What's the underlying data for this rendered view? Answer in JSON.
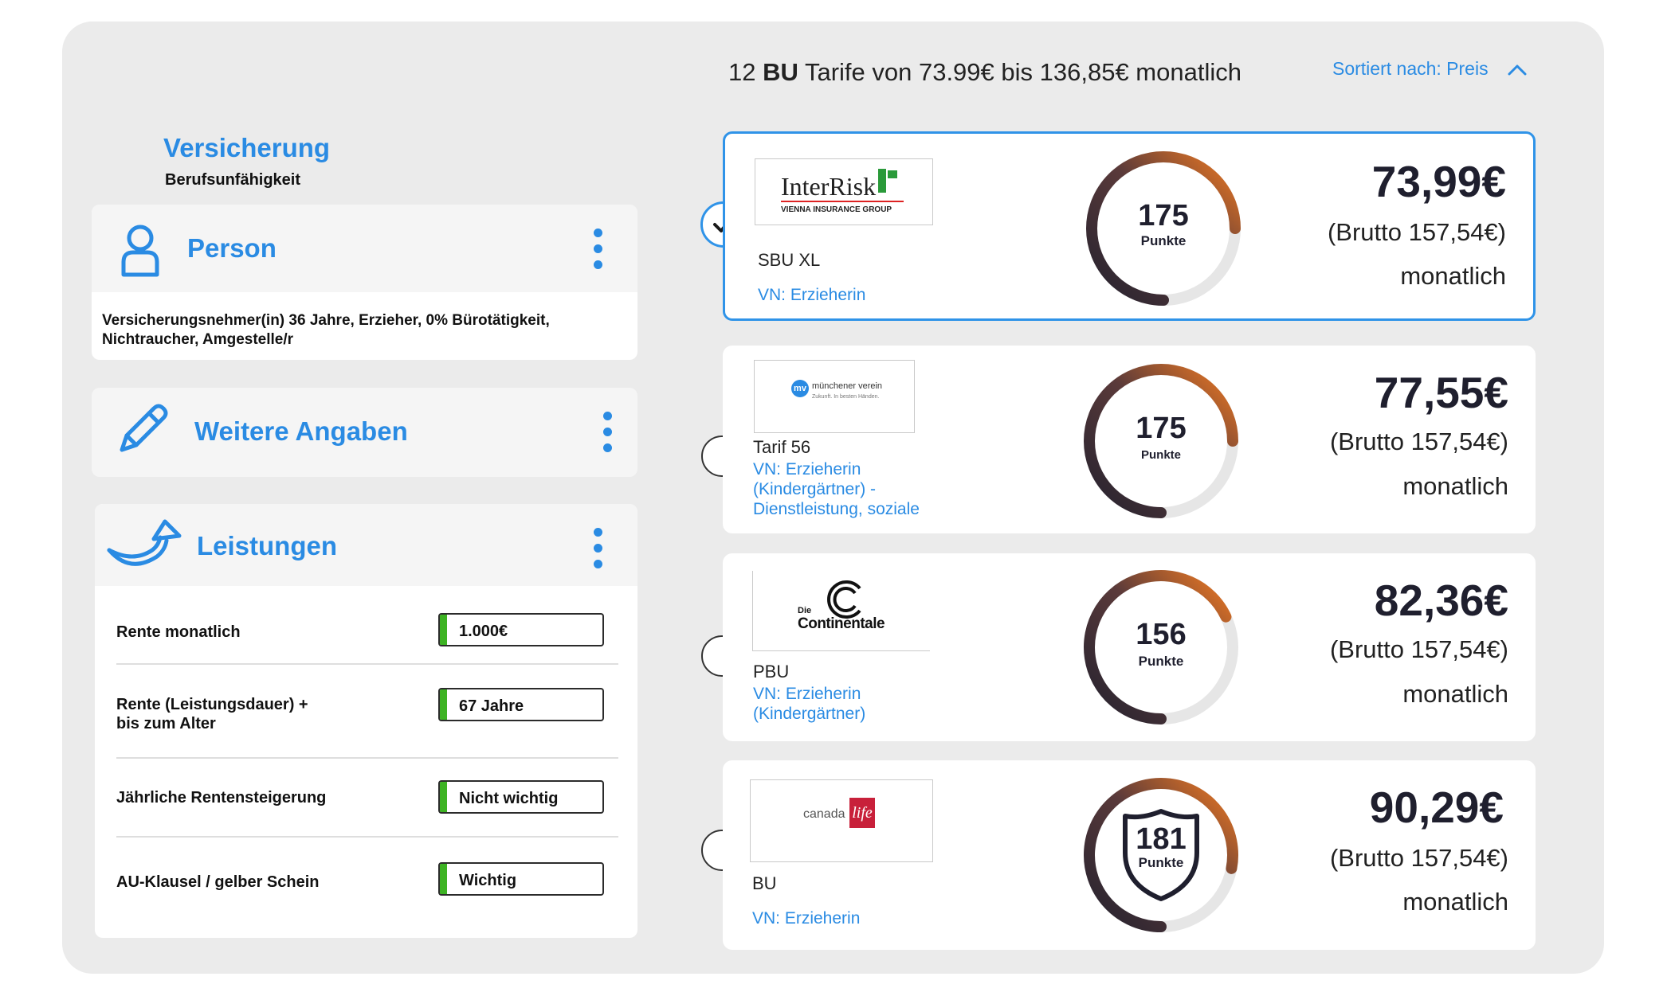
{
  "sidebar": {
    "title": "Versicherung",
    "subtitle": "Berufsunfähigkeit",
    "person": {
      "title": "Person",
      "description": "Versicherungsnehmer(in) 36 Jahre, Erzieher, 0% Bürotätigkeit, Nichtraucher, Amgestelle/r"
    },
    "weitere": {
      "title": "Weitere Angaben"
    },
    "leistungen": {
      "title": "Leistungen",
      "rows": [
        {
          "label": "Rente monatlich",
          "value": "1.000€"
        },
        {
          "label": "Rente (Leistungsdauer) + bis zum Alter",
          "value": "67 Jahre"
        },
        {
          "label": "Jährliche Rentensteigerung",
          "value": "Nicht wichtig"
        },
        {
          "label": "AU-Klausel / gelber Schein",
          "value": "Wichtig"
        }
      ]
    }
  },
  "results": {
    "summary_count": "12",
    "summary_type": "BU",
    "summary_rest": "Tarife von 73.99€ bis 136,85€ monatlich",
    "sort_label": "Sortiert nach: Preis"
  },
  "offers": [
    {
      "logo_text": "InterRisk",
      "logo_sub": "VIENNA INSURANCE GROUP",
      "tarif": "SBU XL",
      "vn": "VN: Erzieherin",
      "score": "175",
      "score_label": "Punkte",
      "score_fraction": 0.75,
      "price": "73,99€",
      "brutto": "(Brutto 157,54€)",
      "period": "monatlich",
      "selected": true
    },
    {
      "logo_text": "münchener verein",
      "logo_sub": "Zukunft. In besten Händen.",
      "logo_badge": "mv",
      "tarif": "Tarif 56",
      "vn": "VN: Erzieherin (Kindergärtner) - Dienstleistung, soziale",
      "score": "175",
      "score_label": "Punkte",
      "score_fraction": 0.75,
      "price": "77,55€",
      "brutto": "(Brutto 157,54€)",
      "period": "monatlich",
      "selected": false
    },
    {
      "logo_text": "Die Continentale",
      "logo_small": "Die",
      "logo_main": "Continentale",
      "tarif": "PBU",
      "vn": "VN: Erzieherin (Kindergärtner)",
      "score": "156",
      "score_label": "Punkte",
      "score_fraction": 0.68,
      "price": "82,36€",
      "brutto": "(Brutto 157,54€)",
      "period": "monatlich",
      "selected": false
    },
    {
      "logo_text": "canada",
      "logo_script": "life",
      "tarif": "BU",
      "vn": "VN: Erzieherin",
      "score": "181",
      "score_label": "Punkte",
      "score_fraction": 0.78,
      "price": "90,29€",
      "brutto": "(Brutto 157,54€)",
      "period": "monatlich",
      "selected": false
    }
  ],
  "colors": {
    "accent": "#2a8be3",
    "gauge_orange": "#f07a22",
    "gauge_dark": "#24222f",
    "value_green": "#3db323"
  }
}
